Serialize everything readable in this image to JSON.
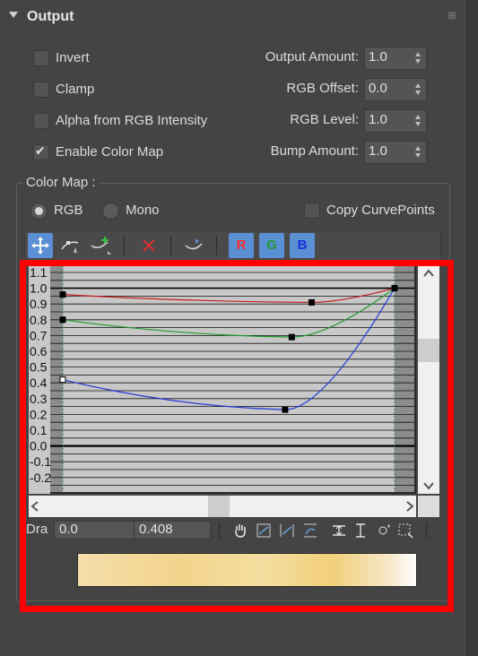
{
  "panel": {
    "title": "Output"
  },
  "options": {
    "invert": {
      "label": "Invert",
      "checked": false
    },
    "clamp": {
      "label": "Clamp",
      "checked": false
    },
    "alpha_from_rgb": {
      "label": "Alpha from RGB Intensity",
      "checked": false
    },
    "enable_color_map": {
      "label": "Enable Color Map",
      "checked": true
    }
  },
  "spinners": {
    "output_amount": {
      "label": "Output Amount:",
      "value": "1.0"
    },
    "rgb_offset": {
      "label": "RGB Offset:",
      "value": "0.0"
    },
    "rgb_level": {
      "label": "RGB Level:",
      "value": "1.0"
    },
    "bump_amount": {
      "label": "Bump Amount:",
      "value": "1.0"
    }
  },
  "color_map": {
    "title": "Color Map :",
    "mode_rgb": "RGB",
    "mode_mono": "Mono",
    "mode_selected": "RGB",
    "copy_curve_points": {
      "label": "Copy CurvePoints",
      "checked": false
    }
  },
  "toolbar": {
    "icons": [
      "move-icon",
      "scale-point-icon",
      "add-point-icon",
      "delete-point-icon",
      "reset-curve-icon"
    ],
    "r_label": "R",
    "g_label": "G",
    "b_label": "B",
    "r_color": "#ff2a2a",
    "g_color": "#1f9a2f",
    "b_color": "#1a2fd8",
    "active_color": "#5b8fd4"
  },
  "curve_graph": {
    "y_tick_labels": [
      "1.1",
      "1.0",
      "0.9",
      "0.8",
      "0.7",
      "0.6",
      "0.5",
      "0.4",
      "0.3",
      "0.2",
      "0.1",
      "0.0",
      "-0.1",
      "-0.2"
    ],
    "curves": [
      {
        "name": "R",
        "color": "#c82020",
        "points": [
          [
            0.0,
            0.96
          ],
          [
            0.75,
            0.91
          ],
          [
            1.0,
            1.0
          ]
        ]
      },
      {
        "name": "G",
        "color": "#1f9a2f",
        "points": [
          [
            0.0,
            0.8
          ],
          [
            0.69,
            0.69
          ],
          [
            1.0,
            1.0
          ]
        ]
      },
      {
        "name": "B",
        "color": "#1f3bd8",
        "points": [
          [
            0.0,
            0.42
          ],
          [
            0.67,
            0.23
          ],
          [
            1.0,
            1.0
          ]
        ]
      }
    ]
  },
  "bottom_bar": {
    "label": "Dra",
    "x_value": "0.0",
    "y_value": "0.408",
    "icons": [
      "pan-hand-icon",
      "zoom-extents-icon",
      "zoom-horizontal-icon",
      "zoom-vertical-icon",
      "zoom-region-icon",
      "zoom-icon",
      "zoom-region-icon-2",
      "region-select-icon"
    ]
  },
  "gradient": {
    "stops": [
      "#f5deab",
      "#f3d48c",
      "#f4dea0",
      "#f2cf7a",
      "#f6e8c8",
      "#ffffff"
    ]
  }
}
